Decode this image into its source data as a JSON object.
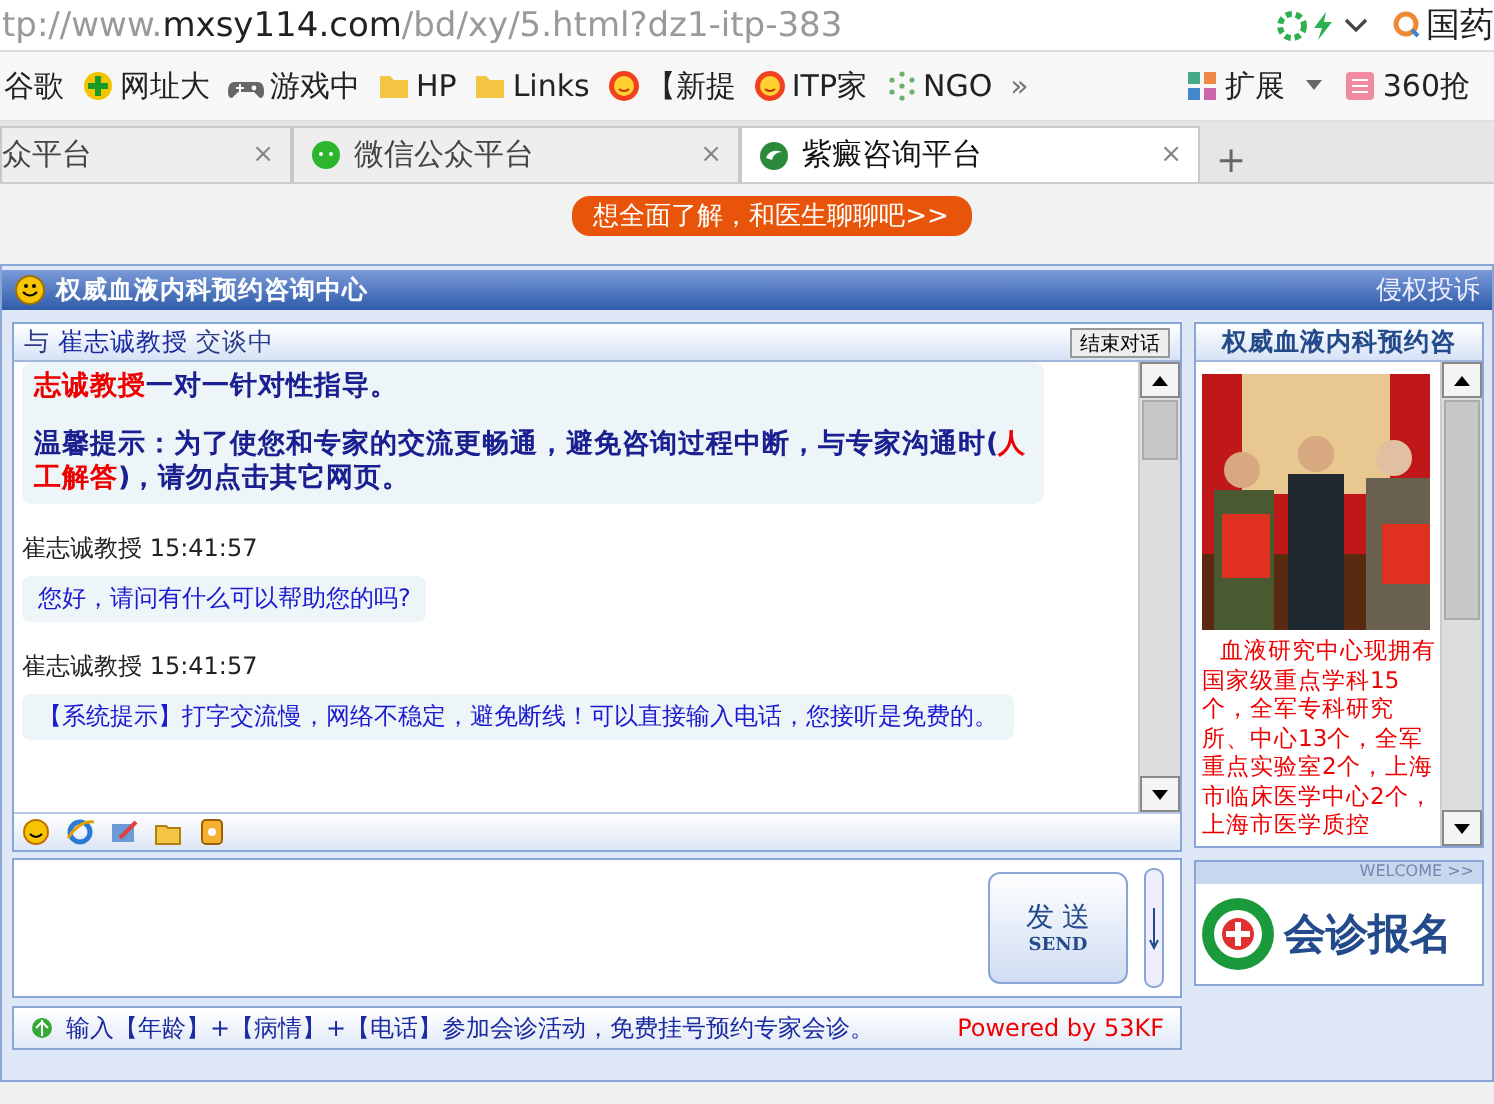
{
  "browser": {
    "url_prefix": "tp://www.",
    "url_domain": "mxsy114.com",
    "url_path": "/bd/xy/5.html?dz1-itp-383",
    "search_text": "国药",
    "bookmarks": [
      {
        "label": "谷歌"
      },
      {
        "label": "网址大"
      },
      {
        "label": "游戏中"
      },
      {
        "label": "HP"
      },
      {
        "label": "Links"
      },
      {
        "label": "【新提"
      },
      {
        "label": "ITP家"
      },
      {
        "label": "NGO"
      }
    ],
    "more": "»",
    "extensions": "扩展",
    "ticket": "360抢",
    "tabs": [
      {
        "label": "众平台",
        "close": "×",
        "selected": false
      },
      {
        "label": "微信公众平台",
        "close": "×",
        "selected": false
      },
      {
        "label": "紫癜咨询平台",
        "close": "×",
        "selected": true
      }
    ],
    "new_tab": "+"
  },
  "banner": "想全面了解，和医生聊聊吧>>",
  "chat": {
    "title": "权威血液内科预约咨询中心",
    "complaint": "侵权投诉",
    "session": {
      "prefix": "与",
      "name": "崔志诚教授",
      "suffix": "交谈中",
      "end_button": "结束对话"
    },
    "messages": [
      {
        "kind": "notice",
        "paragraphs": [
          [
            {
              "text": "志诚教授",
              "emphasis": true
            },
            {
              "text": "一对一针对性指导。",
              "emphasis": false
            }
          ],
          [
            {
              "text": "温馨提示：为了使您和专家的交流更畅通，避免咨询过程中断，与专家沟通时(",
              "emphasis": false
            },
            {
              "text": "人工解答",
              "emphasis": true
            },
            {
              "text": ")，请勿点击其它网页。",
              "emphasis": false
            }
          ]
        ]
      },
      {
        "kind": "reply",
        "sender": "崔志诚教授",
        "time": "15:41:57",
        "text": "您好，请问有什么可以帮助您的吗?"
      },
      {
        "kind": "reply",
        "sender": "崔志诚教授",
        "time": "15:41:57",
        "text": "【系统提示】打字交流慢，网络不稳定，避免断线！可以直接输入电话，您接听是免费的。"
      }
    ],
    "send": {
      "label": "发 送",
      "sublabel": "SEND"
    },
    "status": "输入【年龄】+【病情】+【电话】参加会诊活动，免费挂号预约专家会诊。",
    "powered": "Powered by 53KF",
    "side": {
      "title": "权威血液内科预约咨",
      "text": "血液研究中心现拥有国家级重点学科15个，全军专科研究所、中心13个，全军重点实验室2个，上海市临床医学中心2个，上海市医学质控",
      "welcome": "WELCOME >>",
      "signup": "会诊报名"
    }
  }
}
